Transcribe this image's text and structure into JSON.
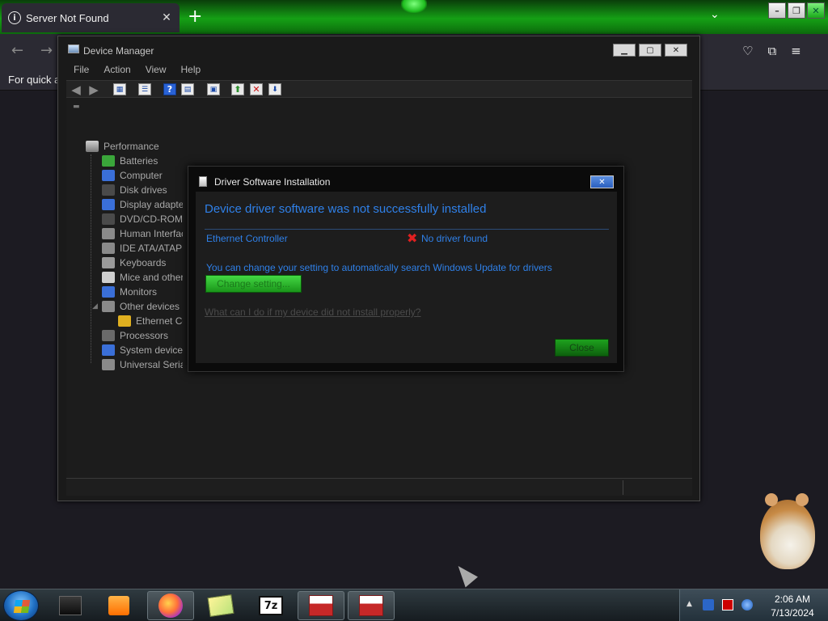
{
  "browser": {
    "tab_title": "Server Not Found",
    "new_tab_symbol": "+",
    "bookmarks_hint": "For quick ac",
    "window_controls": [
      "minimize",
      "restore",
      "close"
    ]
  },
  "device_manager": {
    "title": "Device Manager",
    "menu": [
      "File",
      "Action",
      "View",
      "Help"
    ],
    "tree": {
      "root": "Performance",
      "items": [
        {
          "label": "Batteries",
          "icon": "battery-icon",
          "color": "#3aa63a"
        },
        {
          "label": "Computer",
          "icon": "computer-icon",
          "color": "#3a6fd8"
        },
        {
          "label": "Disk drives",
          "icon": "disk-drive-icon",
          "color": "#4a4a4a"
        },
        {
          "label": "Display adapters",
          "icon": "display-adapter-icon",
          "color": "#3a6fd8"
        },
        {
          "label": "DVD/CD-ROM d",
          "icon": "dvd-drive-icon",
          "color": "#4a4a4a"
        },
        {
          "label": "Human Interface",
          "icon": "hid-icon",
          "color": "#8a8a8a"
        },
        {
          "label": "IDE ATA/ATAPI c",
          "icon": "ide-controller-icon",
          "color": "#8a8a8a"
        },
        {
          "label": "Keyboards",
          "icon": "keyboard-icon",
          "color": "#9a9a9a"
        },
        {
          "label": "Mice and other p",
          "icon": "mouse-icon",
          "color": "#cfcfcf"
        },
        {
          "label": "Monitors",
          "icon": "monitor-icon",
          "color": "#3a6fd8"
        },
        {
          "label": "Other devices",
          "icon": "other-devices-icon",
          "color": "#8a8a8a"
        },
        {
          "label": "Ethernet Con",
          "icon": "warning-device-icon",
          "color": "#e0b020",
          "child": true
        },
        {
          "label": "Processors",
          "icon": "processor-icon",
          "color": "#6a6a6a"
        },
        {
          "label": "System devices",
          "icon": "system-devices-icon",
          "color": "#3a6fd8"
        },
        {
          "label": "Universal Serial E",
          "icon": "usb-icon",
          "color": "#8a8a8a"
        }
      ]
    }
  },
  "dialog": {
    "title": "Driver Software Installation",
    "heading": "Device driver software was not successfully installed",
    "device": "Ethernet Controller",
    "status": "No driver found",
    "info": "You can change your setting to automatically search Windows Update for drivers",
    "change_button": "Change setting...",
    "help_link": "What can I do if my device did not install properly?",
    "close_button": "Close"
  },
  "taskbar": {
    "time": "2:06 AM",
    "date": "7/13/2024"
  }
}
